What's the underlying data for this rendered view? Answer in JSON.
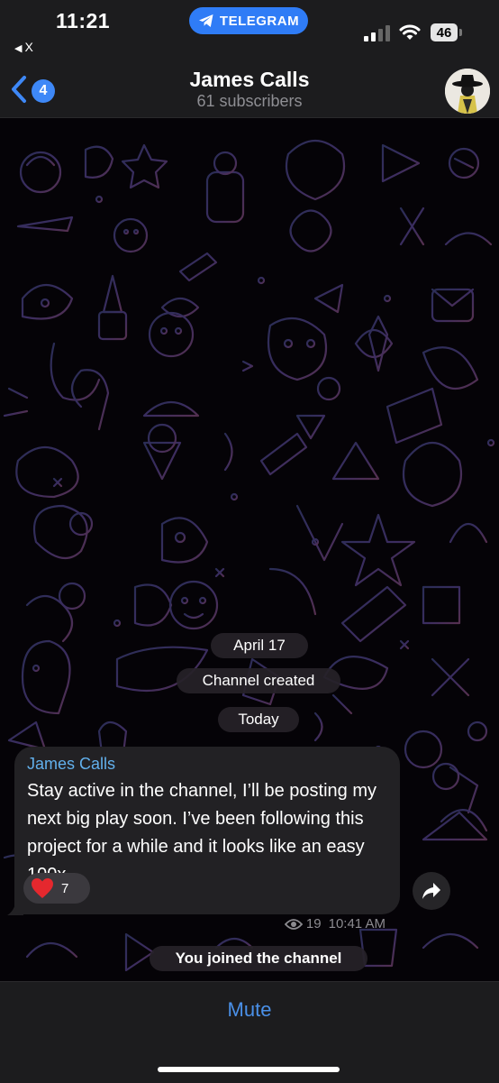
{
  "status_bar": {
    "time": "11:21",
    "back_app": "X",
    "app_pill": "TELEGRAM",
    "battery": "46"
  },
  "header": {
    "unread_count": "4",
    "title": "James Calls",
    "subtitle": "61 subscribers"
  },
  "chat": {
    "service_messages": [
      "April 17",
      "Channel created",
      "Today",
      "You joined the channel"
    ],
    "message": {
      "author": "James Calls",
      "text": "Stay active in the channel, I’ll be posting my next big play soon. I’ve been following this project for a while and it looks like an easy 100x",
      "reaction_emoji": "heart",
      "reaction_count": "7",
      "views": "19",
      "time": "10:41 AM"
    }
  },
  "bottom_bar": {
    "mute_label": "Mute"
  },
  "colors": {
    "accent": "#3e88f7",
    "author": "#62b0ec",
    "mute": "#4a90e8",
    "bubble": "#222124",
    "bars": "#1c1c1e",
    "heart": "#e5282e"
  }
}
